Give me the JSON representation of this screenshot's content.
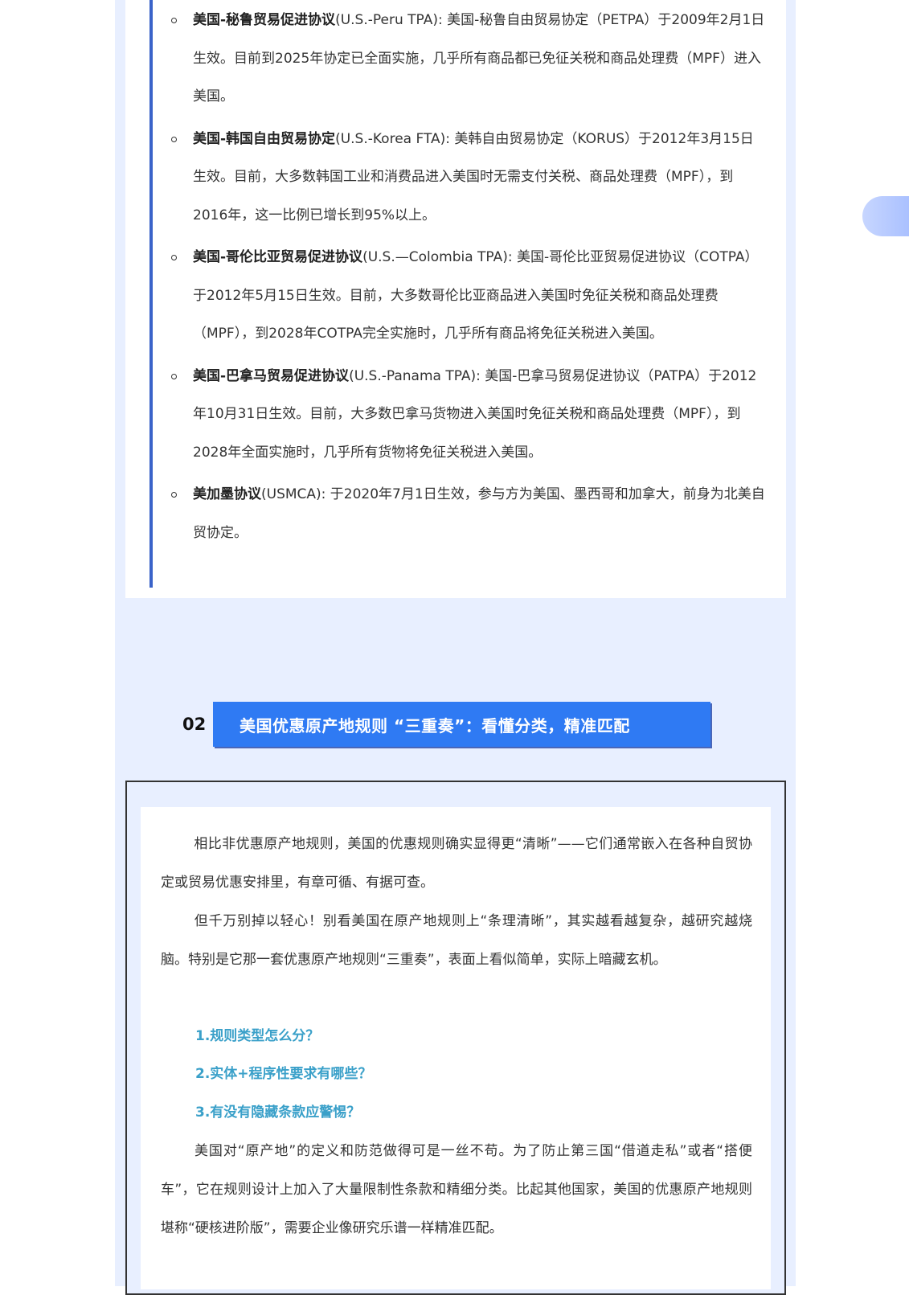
{
  "fta_list": [
    {
      "name": "美国-秘鲁贸易促进协议",
      "rest": "(U.S.-Peru TPA): 美国-秘鲁自由贸易协定（PETPA）于2009年2月1日生效。目前到2025年协定已全面实施，几乎所有商品都已免征关税和商品处理费（MPF）进入美国。"
    },
    {
      "name": "美国-韩国自由贸易协定",
      "rest": "(U.S.-Korea FTA): 美韩自由贸易协定（KORUS）于2012年3月15日生效。目前，大多数韩国工业和消费品进入美国时无需支付关税、商品处理费（MPF），到2016年，这一比例已增长到95%以上。"
    },
    {
      "name": "美国-哥伦比亚贸易促进协议",
      "rest": "(U.S.—Colombia TPA): 美国-哥伦比亚贸易促进协议（COTPA）于2012年5月15日生效。目前，大多数哥伦比亚商品进入美国时免征关税和商品处理费（MPF），到2028年COTPA完全实施时，几乎所有商品将免征关税进入美国。"
    },
    {
      "name": "美国-巴拿马贸易促进协议",
      "rest": "(U.S.-Panama TPA): 美国-巴拿马贸易促进协议（PATPA）于2012年10月31日生效。目前，大多数巴拿马货物进入美国时免征关税和商品处理费（MPF），到2028年全面实施时，几乎所有货物将免征关税进入美国。"
    },
    {
      "name": "美加墨协议",
      "rest": "(USMCA): 于2020年7月1日生效，参与方为美国、墨西哥和加拿大，前身为北美自贸协定。"
    }
  ],
  "section": {
    "number": "02",
    "title": "美国优惠原产地规则 “三重奏”：看懂分类，精准匹配"
  },
  "body": {
    "para1": "相比非优惠原产地规则，美国的优惠规则确实显得更“清晰”——它们通常嵌入在各种自贸协定或贸易优惠安排里，有章可循、有据可查。",
    "para2": "但千万别掉以轻心！别看美国在原产地规则上“条理清晰”，其实越看越复杂，越研究越烧脑。特别是它那一套优惠原产地规则“三重奏”，表面上看似简单，实际上暗藏玄机。",
    "questions": [
      "1.规则类型怎么分？",
      "2.实体+程序性要求有哪些？",
      "3.有没有隐藏条款应警惕？"
    ],
    "para3": "美国对“原产地”的定义和防范做得可是一丝不苟。为了防止第三国“借道走私”或者“搭便车”，它在规则设计上加入了大量限制性条款和精细分类。比起其他国家，美国的优惠原产地规则堪称“硬核进阶版”，需要企业像研究乐谱一样精准匹配。"
  },
  "colors": {
    "page_bg": "#e8efff",
    "accent_bar": "#3a63c9",
    "banner": "#2f7af3",
    "question_text": "#3aa0c9"
  }
}
